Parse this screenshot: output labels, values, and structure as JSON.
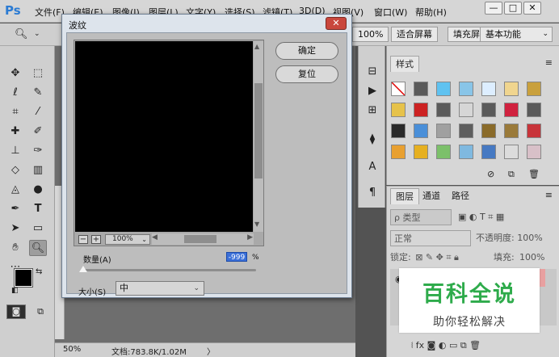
{
  "app": {
    "logo": "Ps"
  },
  "menu": [
    "文件(F)",
    "编辑(E)",
    "图像(I)",
    "图层(L)",
    "文字(Y)",
    "选择(S)",
    "滤镜(T)",
    "3D(D)",
    "视图(V)",
    "窗口(W)",
    "帮助(H)"
  ],
  "window_controls": {
    "minimize": "—",
    "maximize": "□",
    "close": "✕"
  },
  "options_bar": {
    "zoom_percent": "100%",
    "fit_screen": "适合屏幕",
    "fill_screen": "填充屏",
    "workspace": "基本功能"
  },
  "dialog": {
    "title": "波纹",
    "close": "✕",
    "ok": "确定",
    "reset": "复位",
    "zoom_out": "−",
    "zoom_in": "+",
    "zoom": "100%",
    "amount_label": "数量(A)",
    "amount_value": "-999",
    "amount_unit": "%",
    "amount_level": 0.0,
    "size_label": "大小(S)",
    "size_value": "中"
  },
  "styles_panel": {
    "tab": "样式"
  },
  "layers_panel": {
    "tabs": [
      "图层",
      "通道",
      "路径"
    ],
    "filter_label": "ρ 类型",
    "blend_mode": "正常",
    "opacity_label": "不透明度:",
    "opacity_value": "100%",
    "lock_label": "锁定:",
    "fill_label": "填充:",
    "fill_value": "100%"
  },
  "status_bar": {
    "zoom": "50%",
    "doc_info": "文档:783.8K/1.02M",
    "arrow": "〉"
  },
  "watermark": {
    "title": "百科全说",
    "subtitle": "助你轻松解决"
  }
}
